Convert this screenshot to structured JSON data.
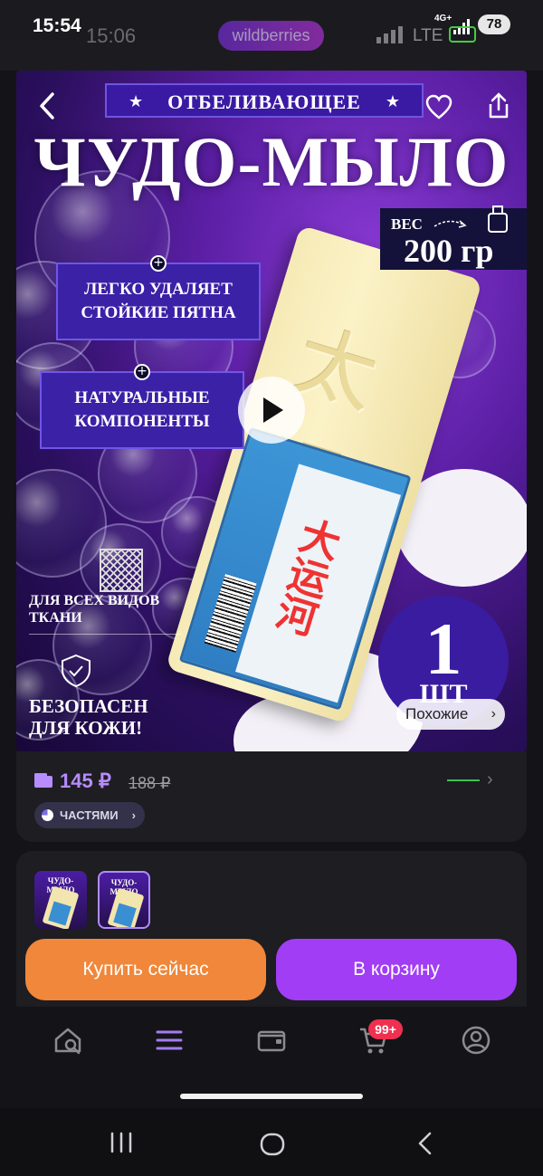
{
  "system_status": {
    "time": "15:54",
    "network": "4G+",
    "battery": "78"
  },
  "app_status": {
    "time": "15:06",
    "store_pill": "wildberries",
    "network": "LTE"
  },
  "product_image": {
    "banner_top": "ОТБЕЛИВАЮЩЕЕ",
    "title": "ЧУДО-МЫЛО",
    "weight_label": "ВЕС",
    "weight_value": "200 гр",
    "feature_1": "ЛЕГКО УДАЛЯЕТ СТОЙКИЕ ПЯТНА",
    "feature_2": "НАТУРАЛЬНЫЕ КОМПОНЕНТЫ",
    "fabric_text": "ДЛЯ ВСЕХ ВИДОВ ТКАНИ",
    "safe_text": "БЕЗОПАСЕН ДЛЯ КОЖИ!",
    "count_number": "1",
    "count_unit": "ШТ",
    "soap_brand": "大运河",
    "similar_label": "Похожие"
  },
  "price": {
    "current": "145 ₽",
    "old": "188 ₽",
    "installments_label": "ЧАСТЯМИ"
  },
  "gallery": {
    "thumb_title": "ЧУДО-МЫЛО"
  },
  "actions": {
    "buy_now": "Купить сейчас",
    "add_to_cart": "В корзину"
  },
  "bottom_nav": {
    "cart_badge": "99+"
  },
  "colors": {
    "accent_purple": "#a13df5",
    "buy_orange": "#f0873a",
    "badge_red": "#f0304f",
    "price_purple": "#b78cff"
  }
}
